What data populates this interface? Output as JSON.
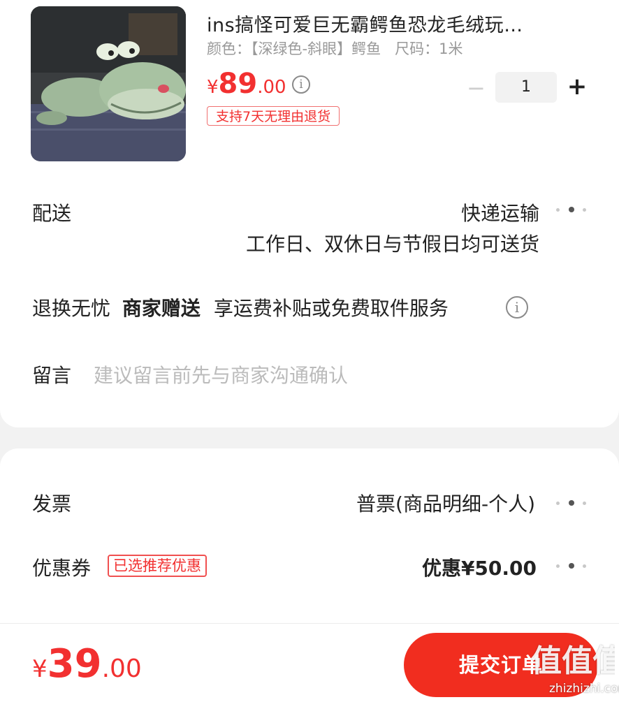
{
  "product": {
    "image_icon": "crocodile-plush-image",
    "title": "ins搞怪可爱巨无霸鳄鱼恐龙毛绒玩…",
    "spec_color": "颜色：【深绿色-斜眼】鳄鱼",
    "spec_size": "尺码：1米",
    "price_currency": "¥",
    "price_int": "89",
    "price_dec": ".00",
    "return_badge": "支持7天无理由退货",
    "quantity": "1",
    "minus_icon": "−",
    "plus_icon": "+"
  },
  "delivery": {
    "label": "配送",
    "method": "快递运输",
    "note": "工作日、双休日与节假日均可送货"
  },
  "return_service": {
    "label": "退换无忧",
    "merchant_gift": "商家赠送",
    "desc": "享运费补贴或免费取件服务"
  },
  "message": {
    "label": "留言",
    "placeholder": "建议留言前先与商家沟通确认"
  },
  "invoice": {
    "label": "发票",
    "value": "普票(商品明细-个人)"
  },
  "coupon": {
    "label": "优惠券",
    "tag": "已选推荐优惠",
    "value": "优惠¥50.00"
  },
  "footer": {
    "total_currency": "¥",
    "total_int": "39",
    "total_dec": ".00",
    "submit_label": "提交订单",
    "watermark_logo": "值值值",
    "watermark_text": "zhizhizhi.com"
  },
  "colors": {
    "accent": "#f23030",
    "submit_bg": "#f12d1f",
    "page_bg": "#f2f2f2"
  }
}
